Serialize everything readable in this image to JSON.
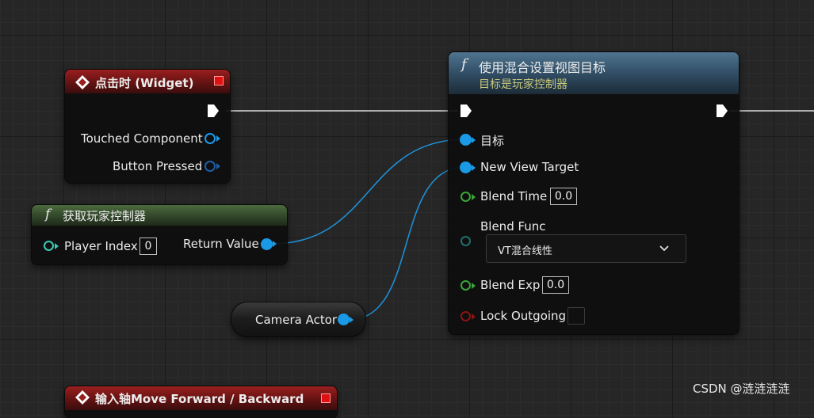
{
  "nodes": {
    "click_event": {
      "title": "点击时 (Widget)",
      "pin_touched": "Touched Component",
      "pin_pressed": "Button Pressed"
    },
    "get_controller": {
      "title": "获取玩家控制器",
      "pin_index": "Player Index",
      "index_value": "0",
      "pin_return": "Return Value"
    },
    "camera_actor": {
      "label": "Camera Actor"
    },
    "set_view_target": {
      "title": "使用混合设置视图目标",
      "subtitle": "目标是玩家控制器",
      "pin_target": "目标",
      "pin_new_view_target": "New View Target",
      "pin_blend_time": "Blend Time",
      "blend_time_value": "0.0",
      "pin_blend_func": "Blend Func",
      "blend_func_value": "VT混合线性",
      "pin_blend_exp": "Blend Exp",
      "blend_exp_value": "0.0",
      "pin_lock_outgoing": "Lock Outgoing"
    },
    "axis_event": {
      "title": "输入轴Move Forward / Backward"
    }
  },
  "icons": {
    "function": "f",
    "event": "diamond-icon",
    "close": "stop-icon"
  },
  "colors": {
    "object_pin": "#1a9ae6",
    "float_pin": "#3aa63a",
    "bool_pin": "#8a1414",
    "event_header": "#8b1a1a",
    "pure_header": "#3f5a34",
    "function_header": "#45677f"
  },
  "watermark": "CSDN @涟涟涟涟"
}
